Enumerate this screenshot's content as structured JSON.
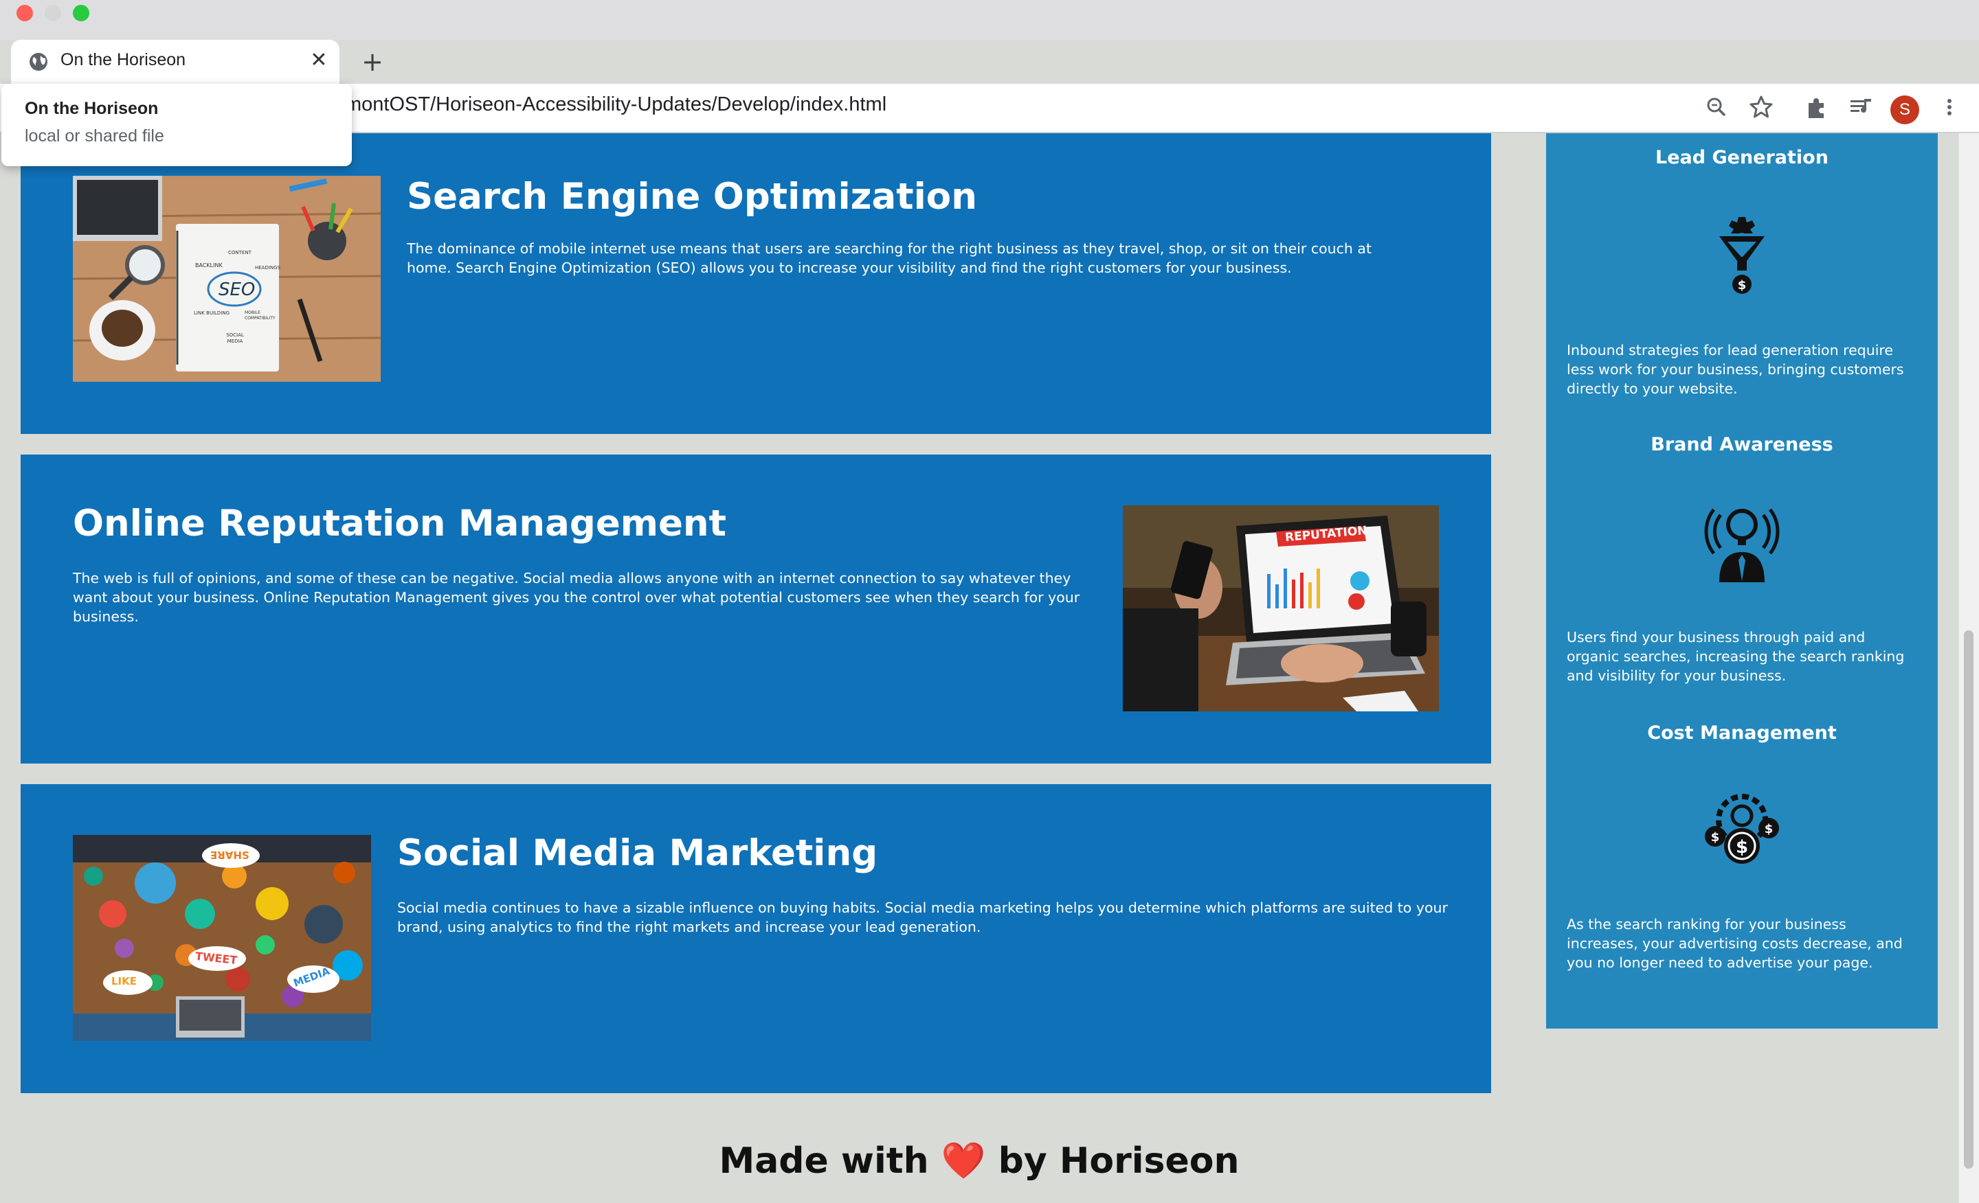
{
  "browser": {
    "tab_title": "On the Horiseon",
    "new_tab_glyph": "+",
    "close_glyph": "✕",
    "url": "montOST/Horiseon-Accessibility-Updates/Develop/index.html",
    "profile_initial": "S",
    "popup": {
      "title": "On the Horiseon",
      "subtitle": "local or shared file"
    },
    "icons": [
      "globe-icon",
      "zoom-icon",
      "star-icon",
      "extensions-icon",
      "media-control-icon",
      "more-menu-icon"
    ]
  },
  "sections": [
    {
      "id": "search-engine-optimization",
      "title": "Search Engine Optimization",
      "text": "The dominance of mobile internet use means that users are searching for the right business as they travel, shop, or sit on their couch at home. Search Engine Optimization (SEO) allows you to increase your visibility and find the right customers for your business.",
      "image_labels": [
        "CONTENT",
        "BACKLINK",
        "HEADINGS",
        "SEO",
        "LINK BUILDING",
        "MOBILE COMPATIBILITY",
        "SOCIAL MEDIA"
      ]
    },
    {
      "id": "online-reputation-management",
      "title": "Online Reputation Management",
      "text": "The web is full of opinions, and some of these can be negative. Social media allows anyone with an internet connection to say whatever they want about your business. Online Reputation Management gives you the control over what potential customers see when they search for your business.",
      "image_labels": [
        "REPUTATION"
      ]
    },
    {
      "id": "social-media-marketing",
      "title": "Social Media Marketing",
      "text": "Social media continues to have a sizable influence on buying habits. Social media marketing helps you determine which platforms are suited to your brand, using analytics to find the right markets and increase your lead generation.",
      "image_labels": [
        "SHARE",
        "TWEET",
        "LIKE",
        "MEDIA"
      ]
    }
  ],
  "benefits": [
    {
      "title": "Lead Generation",
      "icon": "lead-funnel-icon",
      "text": "Inbound strategies for lead generation require less work for your business, bringing customers directly to your website."
    },
    {
      "title": "Brand Awareness",
      "icon": "brand-lightbulb-icon",
      "text": "Users find your business through paid and organic searches, increasing the search ranking and visibility for your business."
    },
    {
      "title": "Cost Management",
      "icon": "cost-gear-icon",
      "text": "As the search ranking for your business increases, your advertising costs decrease, and you no longer need to advertise your page."
    }
  ],
  "footer": {
    "before": "Made with",
    "heart": "❤️",
    "after": "by Horiseon"
  },
  "colors": {
    "section_bg": "#0f71b8",
    "benefits_bg": "#2488bd",
    "page_bg": "#d9dbd6"
  }
}
